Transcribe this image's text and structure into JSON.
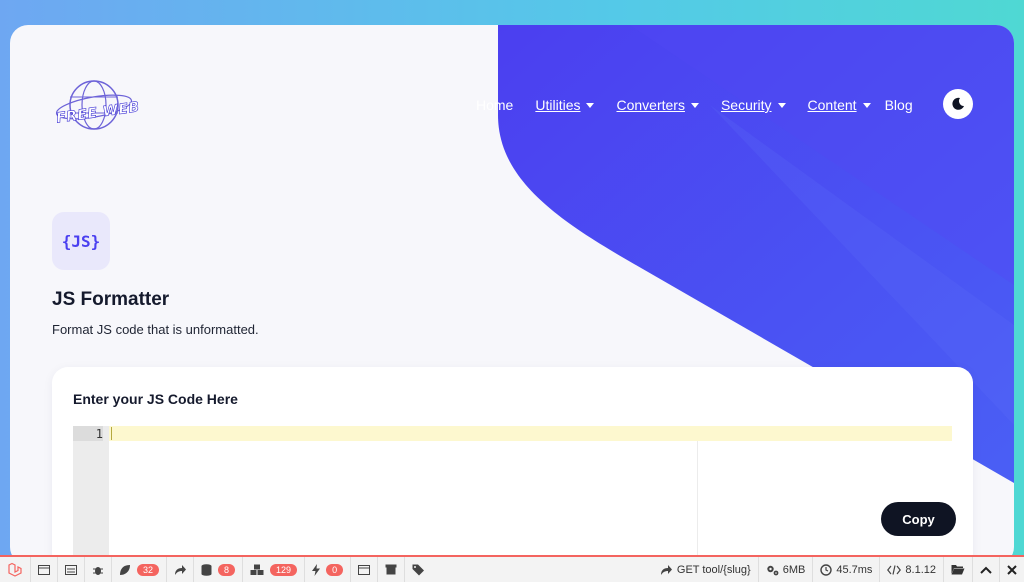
{
  "brand": {
    "logo_text": "FREE WEB"
  },
  "nav": {
    "items": [
      {
        "label": "Home",
        "dropdown": false,
        "underline": false
      },
      {
        "label": "Utilities",
        "dropdown": true,
        "underline": true
      },
      {
        "label": "Converters",
        "dropdown": true,
        "underline": true
      },
      {
        "label": "Security",
        "dropdown": true,
        "underline": true
      },
      {
        "label": "Content",
        "dropdown": true,
        "underline": true
      },
      {
        "label": "Blog",
        "dropdown": false,
        "underline": false
      }
    ],
    "theme_toggle_icon": "moon-icon"
  },
  "tool": {
    "icon_text": "{JS}",
    "title": "JS Formatter",
    "description": "Format JS code that is unformatted."
  },
  "editor_card": {
    "heading": "Enter your JS Code Here",
    "line_number": "1",
    "value": "",
    "copy_label": "Copy"
  },
  "debugbar": {
    "counts": {
      "logs": "32",
      "queries": "8",
      "models": "129",
      "events": "0"
    },
    "route": "GET tool/{slug}",
    "memory": "6MB",
    "time": "45.7ms",
    "php_version": "8.1.12"
  },
  "colors": {
    "accent": "#4a3ff0",
    "accent_light": "#e9e8fb",
    "dark_button": "#0f1423",
    "debug_red": "#f4645f"
  }
}
